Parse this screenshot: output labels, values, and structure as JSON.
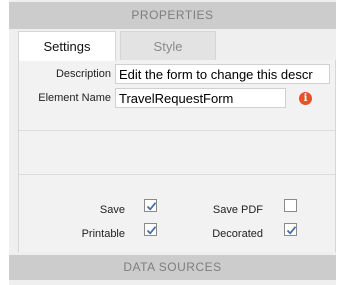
{
  "panel": {
    "header": "PROPERTIES",
    "footer": "DATA SOURCES"
  },
  "tabs": [
    {
      "label": "Settings",
      "active": true
    },
    {
      "label": "Style",
      "active": false
    }
  ],
  "form": {
    "description_label": "Description",
    "description_value": "Edit the form to change this descr",
    "element_name_label": "Element Name",
    "element_name_value": "TravelRequestForm",
    "info_icon": "info-icon",
    "info_color": "#e8502a"
  },
  "options": {
    "save_label": "Save",
    "save_checked": true,
    "save_pdf_label": "Save PDF",
    "save_pdf_checked": false,
    "printable_label": "Printable",
    "printable_checked": true,
    "decorated_label": "Decorated",
    "decorated_checked": true
  }
}
